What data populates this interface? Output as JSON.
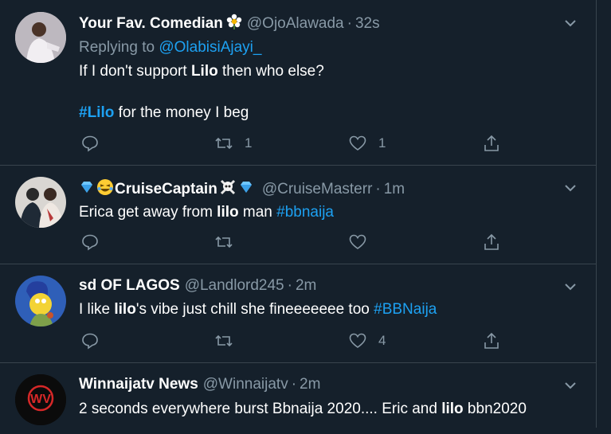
{
  "colors": {
    "background": "#15202b",
    "divider": "#38444d",
    "muted": "#8899a6",
    "link": "#1da1f2"
  },
  "tweets": [
    {
      "name": "Your Fav. Comedian",
      "name_emoji": "flower-emoji",
      "handle": "@OjoAlawada",
      "dot": "·",
      "time": "32s",
      "replying_prefix": "Replying to",
      "replying_handle": "@OlabisiAjayi_",
      "line1": {
        "a": "If I don't support ",
        "b": "Lilo",
        "c": " then who else?"
      },
      "line2": {
        "tag": "#Lilo",
        "rest": " for the money I beg"
      },
      "retweets": "1",
      "likes": "1"
    },
    {
      "name_prefix_emoji": "gem-emoji squinting-face-emoji",
      "name": "CruiseCaptain",
      "name_suffix_emoji": "skull-crossbones-emoji gem-emoji",
      "handle": "@CruiseMasterr",
      "dot": "·",
      "time": "1m",
      "text": {
        "a": "Erica get away from ",
        "b": "lilo",
        "c": " man ",
        "tag": "#bbnaija"
      },
      "retweets": "",
      "likes": ""
    },
    {
      "name": "sd OF LAGOS",
      "handle": "@Landlord245",
      "dot": "·",
      "time": "2m",
      "text": {
        "a": "I like ",
        "b": "lilo",
        "c": "'s vibe just chill she fineeeeeee too ",
        "tag": "#BBNaija"
      },
      "retweets": "",
      "likes": "4"
    },
    {
      "name": "Winnaijatv News",
      "handle": "@Winnaijatv",
      "dot": "·",
      "time": "2m",
      "text": {
        "a": "2 seconds everywhere burst Bbnaija 2020.... Eric and ",
        "b": "lilo",
        "c": " bbn2020"
      },
      "avatar_logo": "WV"
    }
  ]
}
